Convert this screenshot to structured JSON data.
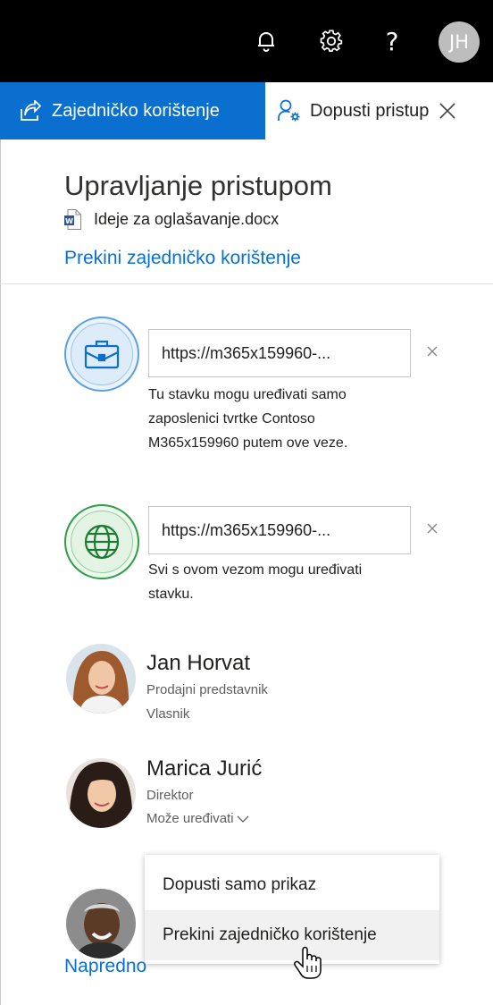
{
  "topbar": {
    "help_label": "?",
    "avatar_initials": "JH"
  },
  "tabs": {
    "share_label": "Zajedničko korištenje",
    "grant_label": "Dopusti pristup"
  },
  "panel": {
    "title": "Upravljanje pristupom",
    "document_name": "Ideje za oglašavanje.docx",
    "stop_sharing_link": "Prekini zajedničko korištenje"
  },
  "links": [
    {
      "icon": "briefcase-icon",
      "url": "https://m365x159960-...",
      "description_lines": [
        "Tu stavku mogu uređivati samo",
        "zaposlenici tvrtke Contoso",
        "M365x159960 putem ove veze."
      ]
    },
    {
      "icon": "globe-icon",
      "url": "https://m365x159960-...",
      "description_lines": [
        "Svi s ovom vezom mogu uređivati",
        "stavku."
      ]
    }
  ],
  "people": [
    {
      "name": "Jan Horvat",
      "role": "Prodajni predstavnik",
      "permission": "Vlasnik"
    },
    {
      "name": "Marica Jurić",
      "role": "Direktor",
      "permission": "Može uređivati"
    }
  ],
  "permission_menu": {
    "items": [
      "Dopusti samo prikaz",
      "Prekini zajedničko korištenje"
    ],
    "hovered_index": 1
  },
  "advanced_link": "Napredno",
  "colors": {
    "accent": "#0a6fcf",
    "topbar": "#000000",
    "org_link_ring": "#5a9fe0",
    "anyone_link_ring": "#2f9e44"
  }
}
